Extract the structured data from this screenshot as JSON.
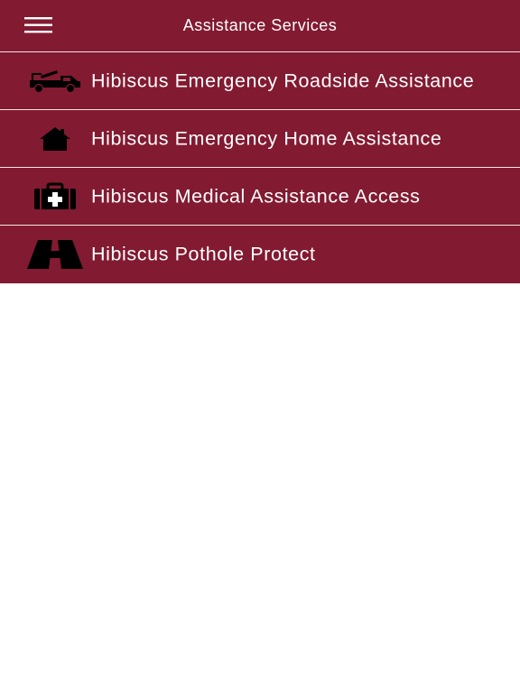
{
  "header": {
    "title": "Assistance Services",
    "menu_icon": "hamburger-menu-icon"
  },
  "colors": {
    "primary": "#821a31",
    "divider": "#f2e4e7",
    "text": "#ffffff",
    "background": "#ffffff"
  },
  "services": [
    {
      "label": "Hibiscus Emergency Roadside Assistance",
      "icon": "tow-truck-icon"
    },
    {
      "label": "Hibiscus Emergency Home Assistance",
      "icon": "house-icon"
    },
    {
      "label": "Hibiscus Medical Assistance Access",
      "icon": "first-aid-kit-icon"
    },
    {
      "label": "Hibiscus Pothole Protect",
      "icon": "road-icon"
    }
  ]
}
